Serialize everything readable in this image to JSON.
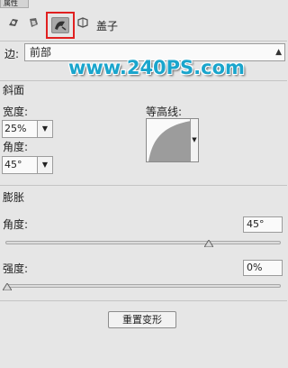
{
  "panel": {
    "tab_title": "属性"
  },
  "toolbar": {
    "icons": [
      "pixel-mask-icon",
      "vector-mask-icon",
      "bevel-icon",
      "warp-icon"
    ],
    "title": "盖子"
  },
  "edge": {
    "label": "边:",
    "value": "前部"
  },
  "watermark": "www.240PS.com",
  "bevel": {
    "section_title": "斜面",
    "width_label": "宽度:",
    "width_value": "25%",
    "angle_label": "角度:",
    "angle_value": "45°",
    "contour_label": "等高线:"
  },
  "inflate": {
    "section_title": "膨胀",
    "angle_label": "角度:",
    "angle_value": "45°",
    "angle_slider_fraction": 0.74,
    "strength_label": "强度:",
    "strength_value": "0%",
    "strength_slider_fraction": 0.0
  },
  "reset_button": "重置变形",
  "colors": {
    "highlight": "#e02020",
    "watermark": "#1aa5cc"
  }
}
